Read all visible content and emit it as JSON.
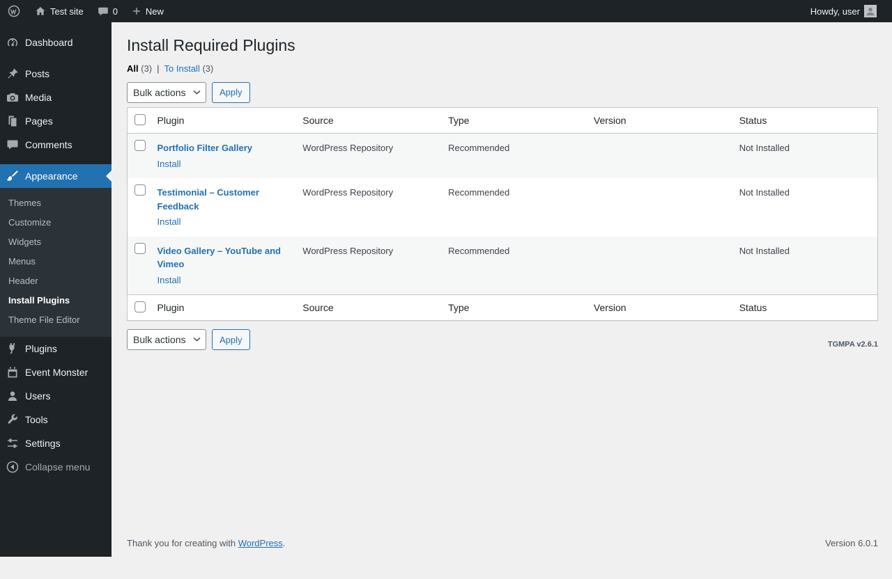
{
  "admin_bar": {
    "site_name": "Test site",
    "comments_count": "0",
    "new_label": "New",
    "howdy_text": "Howdy, user"
  },
  "sidebar": {
    "dashboard": "Dashboard",
    "posts": "Posts",
    "media": "Media",
    "pages": "Pages",
    "comments": "Comments",
    "appearance": "Appearance",
    "appearance_submenu": {
      "themes": "Themes",
      "customize": "Customize",
      "widgets": "Widgets",
      "menus": "Menus",
      "header": "Header",
      "install_plugins": "Install Plugins",
      "theme_file_editor": "Theme File Editor"
    },
    "plugins": "Plugins",
    "event_monster": "Event Monster",
    "users": "Users",
    "tools": "Tools",
    "settings": "Settings",
    "collapse_menu": "Collapse menu"
  },
  "main": {
    "page_title": "Install Required Plugins",
    "filters": {
      "all_label": "All",
      "all_count": "(3)",
      "separator": "|",
      "to_install_label": "To Install",
      "to_install_count": "(3)"
    },
    "bulk_actions_label": "Bulk actions",
    "apply_label": "Apply",
    "table": {
      "headers": {
        "plugin": "Plugin",
        "source": "Source",
        "type": "Type",
        "version": "Version",
        "status": "Status"
      },
      "rows": [
        {
          "plugin_name": "Portfolio Filter Gallery",
          "action_label": "Install",
          "source": "WordPress Repository",
          "type": "Recommended",
          "version": "",
          "status": "Not Installed"
        },
        {
          "plugin_name": "Testimonial – Customer Feedback",
          "action_label": "Install",
          "source": "WordPress Repository",
          "type": "Recommended",
          "version": "",
          "status": "Not Installed"
        },
        {
          "plugin_name": "Video Gallery – YouTube and Vimeo",
          "action_label": "Install",
          "source": "WordPress Repository",
          "type": "Recommended",
          "version": "",
          "status": "Not Installed"
        }
      ]
    },
    "tgmpa_version": "TGMPA v2.6.1"
  },
  "footer": {
    "thanks_prefix": "Thank you for creating with ",
    "wordpress_link_label": "WordPress",
    "thanks_suffix": ".",
    "version_text": "Version 6.0.1"
  },
  "colors": {
    "admin_bar_bg": "#1d2327",
    "menu_bg": "#1d2327",
    "submenu_bg": "#2c3338",
    "active_item_bg": "#2271b1",
    "link_color": "#2271b1",
    "content_bg": "#f0f0f1",
    "table_border": "#c3c4c7"
  }
}
